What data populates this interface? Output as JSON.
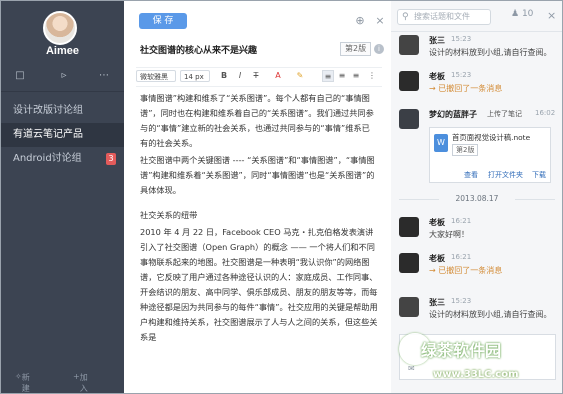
{
  "sidebar": {
    "username": "Aimee",
    "items": [
      {
        "label": "设计改版讨论组"
      },
      {
        "label": "有道云笔记产品"
      },
      {
        "label": "Android讨论组",
        "badge": "3"
      }
    ],
    "bottom": {
      "new_group": "新建群",
      "join_group": "加入群"
    }
  },
  "editor": {
    "save_label": "保 存",
    "title": "社交图谱的核心从来不是兴趣",
    "version": "第2版",
    "toolbar": {
      "font": "微软雅黑",
      "size": "14 px"
    },
    "paragraphs": [
      "事情图谱”构建和维系了“关系图谱”。每个人都有自己的“事情图谱”，同时也在构建和维系着自己的“关系图谱”。我们通过共同参与的“事情”建立新的社会关系，也通过共同参与的“事情”维系已有的社会关系。",
      "社交图谱中两个关键图谱 ---- “关系图谱”和“事情图谱”，“事情图谱”构建和维系着“关系图谱”，同时“事情图谱”也是“关系图谱”的具体体现。",
      "社交关系的纽带",
      "2010 年 4 月 22 日，Facebook CEO 马克・扎克伯格发表演讲引入了社交图谱（Open Graph）的概念 —— 一个将人们和不同事物联系起来的地图。社交图谱是一种表明“我认识你”的网络图谱，它反映了用户通过各种途径认识的人：家庭成员、工作同事、开会结识的朋友、高中同学、俱乐部成员、朋友的朋友等等，而每种途径都是因为共同参与的每件“事情”。社交应用的关键是帮助用户构建和维持关系，社交图谱展示了人与人之间的关系，但这些关系是"
    ]
  },
  "right": {
    "search_placeholder": "搜索话题和文件",
    "member_count": "10",
    "messages": [
      {
        "name": "张三",
        "time": "15:23",
        "text": "设计的材料放到小组,请自行查阅。"
      },
      {
        "name": "老板",
        "time": "15:23",
        "text": "已撤回了一条消息"
      },
      {
        "name": "梦幻的蓝胖子",
        "action": "上传了笔记",
        "time": "16:02",
        "file": {
          "name": "首页面视觉设计稿.note",
          "version": "第2版",
          "actions": [
            "查看",
            "打开文件夹",
            "下载"
          ]
        }
      },
      {
        "name": "老板",
        "time": "16:21",
        "text": "大家好啊！"
      },
      {
        "name": "老板",
        "time": "16:21",
        "text": "已撤回了一条消息"
      },
      {
        "name": "张三",
        "time": "15:23",
        "text": "设计的材料放到小组,请自行查阅。"
      }
    ],
    "date_separator": "2013.08.17"
  },
  "watermark": {
    "line1": "绿茶软件园",
    "line2": "www.33LC.com"
  },
  "colors": {
    "sidebar_bg": "#3c4452",
    "accent": "#5a99e8",
    "badge": "#e35b5b",
    "recall": "#d38b35"
  }
}
